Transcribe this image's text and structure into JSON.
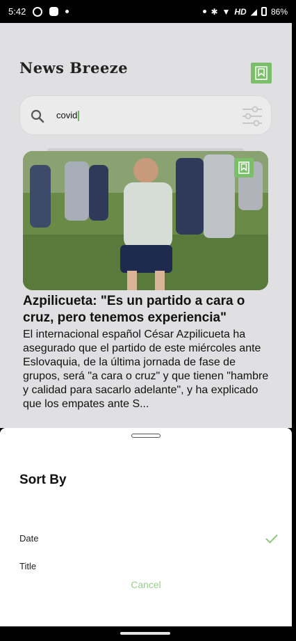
{
  "status_bar": {
    "time": "5:42",
    "network": "HD",
    "battery": "86%"
  },
  "app": {
    "title": "News Breeze",
    "search": {
      "value": "covid",
      "placeholder": ""
    },
    "article": {
      "title": "Azpilicueta: \"Es un partido a cara o cruz, pero tenemos experiencia\"",
      "description": "El internacional español César Azpilicueta ha asegurado que el partido de este miércoles ante Eslovaquia, de la última jornada de fase de grupos, será \"a cara o cruz\" y que tienen \"hambre y calidad para sacarlo adelante\", y ha explicado que los empates ante S..."
    }
  },
  "sort_sheet": {
    "title": "Sort By",
    "options": [
      {
        "label": "Date",
        "selected": true
      },
      {
        "label": "Title",
        "selected": false
      }
    ],
    "cancel_label": "Cancel"
  },
  "colors": {
    "accent": "#7bbf6a",
    "cancel": "#9ccf8e",
    "scrim_background": "#e0e0e2"
  }
}
